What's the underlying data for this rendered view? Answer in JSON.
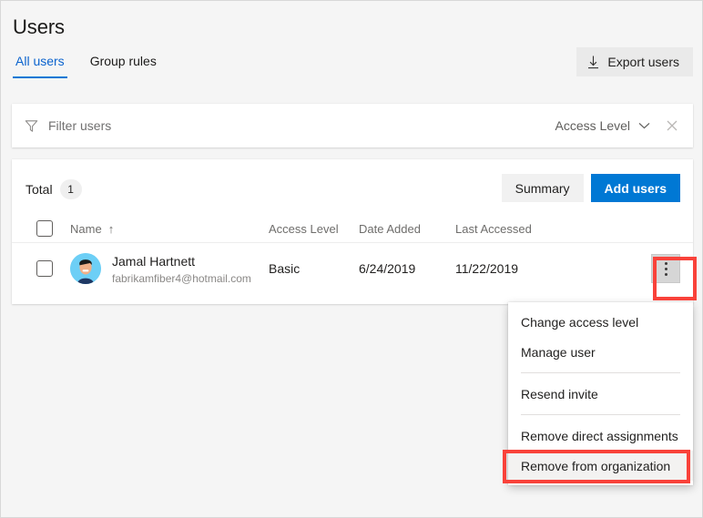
{
  "header": {
    "title": "Users",
    "tabs": [
      {
        "label": "All users",
        "active": true
      },
      {
        "label": "Group rules",
        "active": false
      }
    ],
    "export_button": {
      "label": "Export users",
      "icon": "download-icon"
    }
  },
  "filter_bar": {
    "filter_icon": "funnel-icon",
    "placeholder": "Filter users",
    "access_level_dropdown": {
      "label": "Access Level",
      "icon": "chevron-down-icon"
    },
    "close_icon": "close-icon"
  },
  "toolbar": {
    "total_label": "Total",
    "total_count": "1",
    "summary_label": "Summary",
    "add_users_label": "Add users"
  },
  "table": {
    "columns": {
      "name": "Name",
      "sort_indicator": "↑",
      "access_level": "Access Level",
      "date_added": "Date Added",
      "last_accessed": "Last Accessed"
    },
    "rows": [
      {
        "name": "Jamal Hartnett",
        "email": "fabrikamfiber4@hotmail.com",
        "access_level": "Basic",
        "date_added": "6/24/2019",
        "last_accessed": "11/22/2019",
        "avatar": "user-avatar",
        "more_actions_icon": "vertical-ellipsis-icon"
      }
    ]
  },
  "context_menu": {
    "items": [
      {
        "label": "Change access level",
        "separator_after": false,
        "highlighted": false
      },
      {
        "label": "Manage user",
        "separator_after": true,
        "highlighted": false
      },
      {
        "label": "Resend invite",
        "separator_after": true,
        "highlighted": false
      },
      {
        "label": "Remove direct assignments",
        "separator_after": false,
        "highlighted": false
      },
      {
        "label": "Remove from organization",
        "separator_after": false,
        "highlighted": true
      }
    ]
  },
  "annotations": {
    "highlight_color": "#f9423a",
    "targets": [
      "more-actions-button",
      "remove-from-organization-menu-item"
    ]
  },
  "colors": {
    "accent": "#0078d4",
    "page_background": "#f5f5f5",
    "card_background": "#ffffff",
    "muted_text": "#6e6d6b"
  }
}
